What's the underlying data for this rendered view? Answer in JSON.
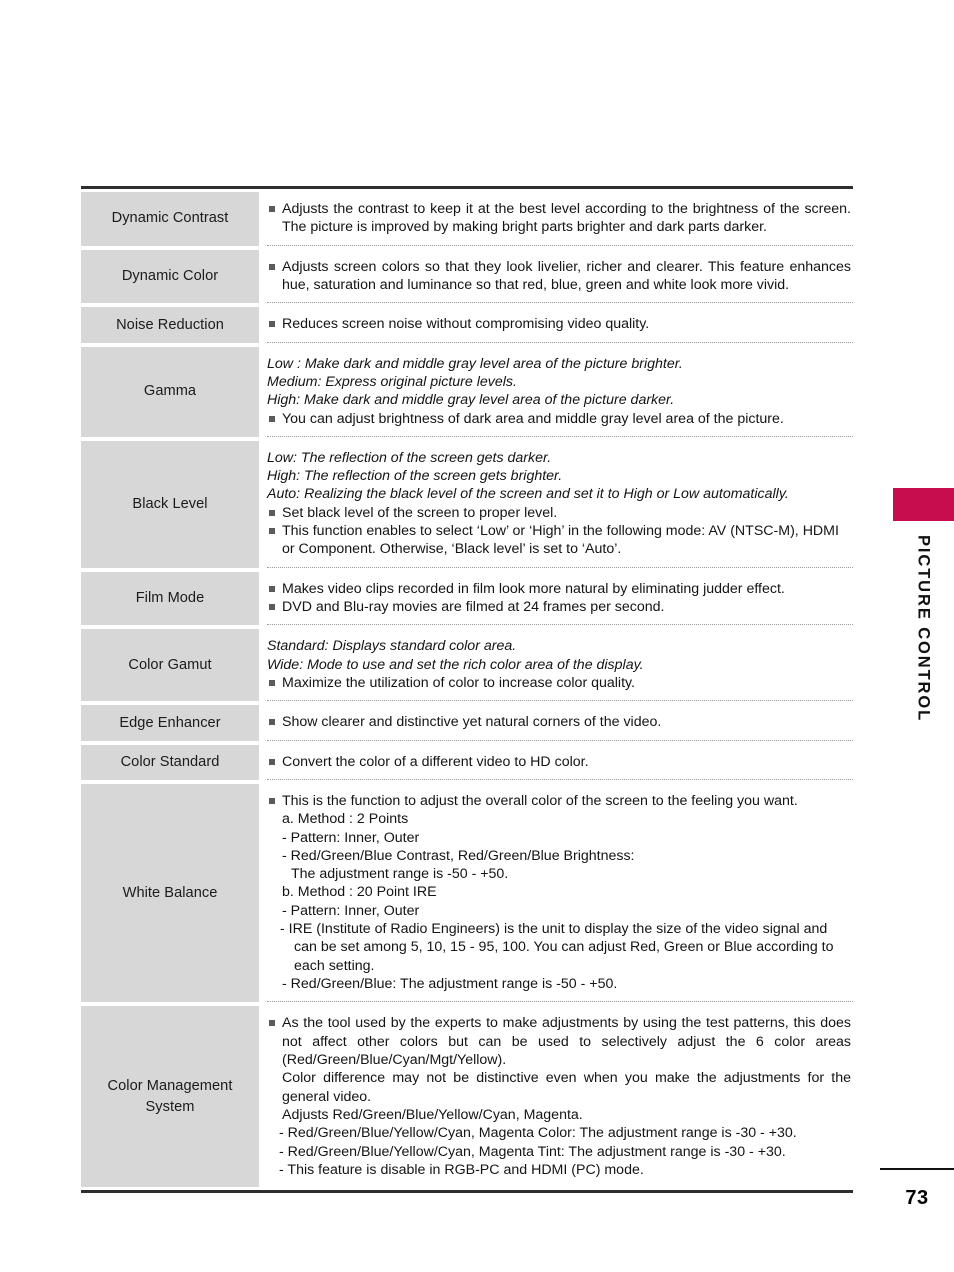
{
  "page": {
    "number": "73",
    "chapter_title": "PICTURE CONTROL",
    "marker_color": "#C80D4E"
  },
  "table": {
    "rows": [
      {
        "label": "Dynamic Contrast",
        "lines": [
          {
            "style": "bullet-justify",
            "text": "Adjusts the contrast to keep it at the best level according to the brightness of the screen. The picture is improved by making bright parts brighter and dark parts darker."
          }
        ]
      },
      {
        "label": "Dynamic Color",
        "lines": [
          {
            "style": "bullet-justify",
            "text": "Adjusts screen colors so that they look livelier, richer and clearer. This feature enhances hue, saturation and luminance so that red, blue, green and white look more vivid."
          }
        ]
      },
      {
        "label": "Noise Reduction",
        "lines": [
          {
            "style": "bullet",
            "text": "Reduces screen noise without compromising video quality."
          }
        ]
      },
      {
        "label": "Gamma",
        "lines": [
          {
            "style": "italic",
            "text": "Low : Make dark and middle gray level area of the picture brighter."
          },
          {
            "style": "italic",
            "text": "Medium: Express original picture levels."
          },
          {
            "style": "italic",
            "text": "High: Make dark and middle gray level area of the picture darker."
          },
          {
            "style": "bullet",
            "text": "You can adjust brightness of dark area and middle gray level area of the picture."
          }
        ]
      },
      {
        "label": "Black Level",
        "lines": [
          {
            "style": "italic",
            "text": "Low: The reflection of the screen gets darker."
          },
          {
            "style": "italic",
            "text": "High: The reflection of the screen gets brighter."
          },
          {
            "style": "italic",
            "text": "Auto: Realizing the black level of the screen and set it to High or Low automatically."
          },
          {
            "style": "bullet",
            "text": "Set black level of the screen to proper level."
          },
          {
            "style": "bullet",
            "text": "This function enables to select ‘Low’ or ‘High’ in the following mode: AV (NTSC-M), HDMI or Component. Otherwise, ‘Black level’ is set to ‘Auto’."
          }
        ]
      },
      {
        "label": "Film Mode",
        "lines": [
          {
            "style": "bullet",
            "text": "Makes video clips recorded in film look more natural by eliminating judder effect."
          },
          {
            "style": "bullet",
            "text": "DVD and Blu-ray movies are filmed at 24 frames per second."
          }
        ]
      },
      {
        "label": "Color Gamut",
        "lines": [
          {
            "style": "italic",
            "text": "Standard: Displays standard color area."
          },
          {
            "style": "italic",
            "text": "Wide: Mode to use and set the rich color area of the display."
          },
          {
            "style": "bullet",
            "text": "Maximize the utilization of color to increase color quality."
          }
        ]
      },
      {
        "label": "Edge Enhancer",
        "lines": [
          {
            "style": "bullet",
            "text": "Show clearer and distinctive yet natural corners of the video."
          }
        ]
      },
      {
        "label": "Color Standard",
        "lines": [
          {
            "style": "bullet",
            "text": "Convert the color of a different video to HD color."
          }
        ]
      },
      {
        "label": "White Balance",
        "lines": [
          {
            "style": "bullet",
            "text": "This is the function to adjust the overall color of the screen to the feeling you want."
          },
          {
            "style": "plain",
            "text": "a. Method : 2 Points"
          },
          {
            "style": "plain",
            "text": "- Pattern: Inner, Outer"
          },
          {
            "style": "plain",
            "text": "- Red/Green/Blue Contrast, Red/Green/Blue Brightness:"
          },
          {
            "style": "plain-indent",
            "text": "The adjustment range is -50 - +50."
          },
          {
            "style": "plain",
            "text": "b. Method : 20 Point IRE"
          },
          {
            "style": "plain",
            "text": "- Pattern: Inner, Outer"
          },
          {
            "style": "plain-hang",
            "text": "- IRE (Institute of Radio Engineers) is the unit to display the size of the video signal and can be set among 5, 10, 15 - 95, 100. You can adjust Red, Green or Blue according to each setting."
          },
          {
            "style": "plain",
            "text": "- Red/Green/Blue: The adjustment range is -50 - +50."
          }
        ]
      },
      {
        "label": "Color Management System",
        "label_lines": [
          "Color Management",
          "System"
        ],
        "lines": [
          {
            "style": "bullet-justify",
            "text": "As the tool used by the experts to make adjustments by using the test patterns, this does not affect other colors but can be used to selectively adjust the 6 color areas (Red/Green/Blue/Cyan/Mgt/Yellow)."
          },
          {
            "style": "plain-justify",
            "text": "Color difference may not be distinctive even when you make the adjustments for the general video."
          },
          {
            "style": "plain",
            "text": "Adjusts Red/Green/Blue/Yellow/Cyan, Magenta."
          },
          {
            "style": "dash-justify",
            "text": "- Red/Green/Blue/Yellow/Cyan, Magenta Color: The adjustment range is -30 - +30."
          },
          {
            "style": "dash",
            "text": "- Red/Green/Blue/Yellow/Cyan, Magenta Tint: The adjustment range is -30 - +30."
          },
          {
            "style": "dash",
            "text": "- This feature is disable in RGB-PC and HDMI (PC) mode."
          }
        ]
      }
    ]
  }
}
